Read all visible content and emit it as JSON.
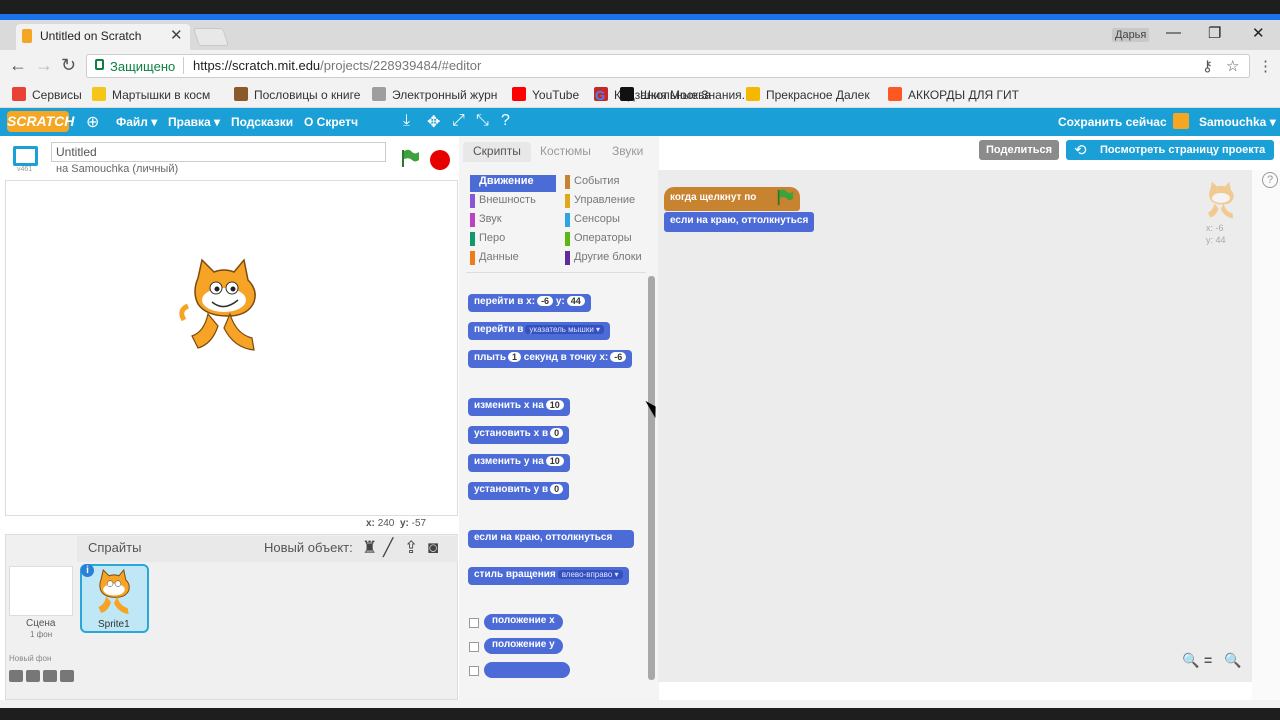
{
  "browser": {
    "tab_title": "Untitled on Scratch",
    "tab_close": "✕",
    "window_user": "Дарья",
    "win_minimize": "—",
    "win_restore": "❐",
    "win_close": "✕",
    "secure_label": "Защищено",
    "url_host": "https://scratch.mit.edu",
    "url_path": "/projects/228939484/#editor",
    "nav_back": "←",
    "nav_forward": "→",
    "nav_reload": "↻",
    "key_icon": "⚷",
    "star_icon": "☆",
    "menu_icon": "⋮",
    "bookmarks": [
      {
        "label": "Сервисы",
        "color": "#e94235"
      },
      {
        "label": "Мартышки в косм",
        "color": "#f5c518"
      },
      {
        "label": "Пословицы о книге",
        "color": "#8b5a2b"
      },
      {
        "label": "Электронный журн",
        "color": "#9e9e9e"
      },
      {
        "label": "YouTube",
        "color": "#ff0000"
      },
      {
        "label": "Кидзания Москва",
        "color": "#c62828"
      },
      {
        "label": "Школьные Знания.",
        "color": "#111111"
      },
      {
        "label": "Прекрасное Далек",
        "color": "#f5b800"
      },
      {
        "label": "АККОРДЫ ДЛЯ ГИТ",
        "color": "#ff5722"
      }
    ],
    "google_g": "G"
  },
  "scratch_bar": {
    "logo": "SCRATCH",
    "menu_file": "Файл ▾",
    "menu_edit": "Правка ▾",
    "menu_tips": "Подсказки",
    "menu_about": "О Скретч",
    "save_now": "Сохранить сейчас",
    "user": "Samouchka ▾",
    "globe_icon": "⊕",
    "tools": [
      "⤓",
      "✥",
      "⤢",
      "⤡",
      "?"
    ]
  },
  "stage": {
    "title": "Untitled",
    "owner": "на Samouchka (личный)",
    "version": "v461",
    "coords_x_label": "x:",
    "coords_x": "240",
    "coords_y_label": "y:",
    "coords_y": "-57"
  },
  "sprites": {
    "title": "Спрайты",
    "new_object": "Новый объект:",
    "scene_label": "Сцена",
    "scene_sub": "1 фон",
    "new_backdrop": "Новый фон",
    "sprite_name": "Sprite1",
    "info": "i",
    "new_icons": [
      "♜",
      "╱",
      "⇪",
      "◙"
    ]
  },
  "palette": {
    "tabs": [
      "Скрипты",
      "Костюмы",
      "Звуки"
    ],
    "categories_left": [
      {
        "label": "Движение",
        "color": "#4a6cd4"
      },
      {
        "label": "Внешность",
        "color": "#8a55d7"
      },
      {
        "label": "Звук",
        "color": "#bb42c3"
      },
      {
        "label": "Перо",
        "color": "#0e9a6c"
      },
      {
        "label": "Данные",
        "color": "#ee7d16"
      }
    ],
    "categories_right": [
      {
        "label": "События",
        "color": "#c88330"
      },
      {
        "label": "Управление",
        "color": "#e1a91a"
      },
      {
        "label": "Сенсоры",
        "color": "#2ca5e2"
      },
      {
        "label": "Операторы",
        "color": "#5cb712"
      },
      {
        "label": "Другие блоки",
        "color": "#632d99"
      }
    ],
    "blocks": {
      "goto_xy": "перейти в x:",
      "goto_x_val": "-6",
      "goto_y_label": "y:",
      "goto_y_val": "44",
      "goto_target": "перейти в",
      "goto_target_val": "указатель мышки ▾",
      "glide": "плыть",
      "glide_secs": "1",
      "glide_mid": "секунд в точку x:",
      "glide_x": "-6",
      "change_x": "изменить x на",
      "change_x_val": "10",
      "set_x": "установить x в",
      "set_x_val": "0",
      "change_y": "изменить у на",
      "change_y_val": "10",
      "set_y": "установить у в",
      "set_y_val": "0",
      "bounce": "если на краю, оттолкнуться",
      "rotation": "стиль вращения",
      "rotation_val": "влево-вправо ▾",
      "pos_x": "положение x",
      "pos_y": "положение у"
    }
  },
  "scripts": {
    "share": "Поделиться",
    "view_project": "Посмотреть страницу проекта",
    "view_icon": "⟲",
    "hat": "когда щелкнут по",
    "bounce": "если на краю, оттолкнуться",
    "sprite_x": "x: -6",
    "sprite_y": "y: 44",
    "help": "?",
    "zoom_out": "🔍",
    "zoom_reset": "=",
    "zoom_in": "🔍"
  },
  "colors": {
    "scratch_blue": "#1aa0d7",
    "motion": "#4c6bd6",
    "events": "#c88330"
  }
}
